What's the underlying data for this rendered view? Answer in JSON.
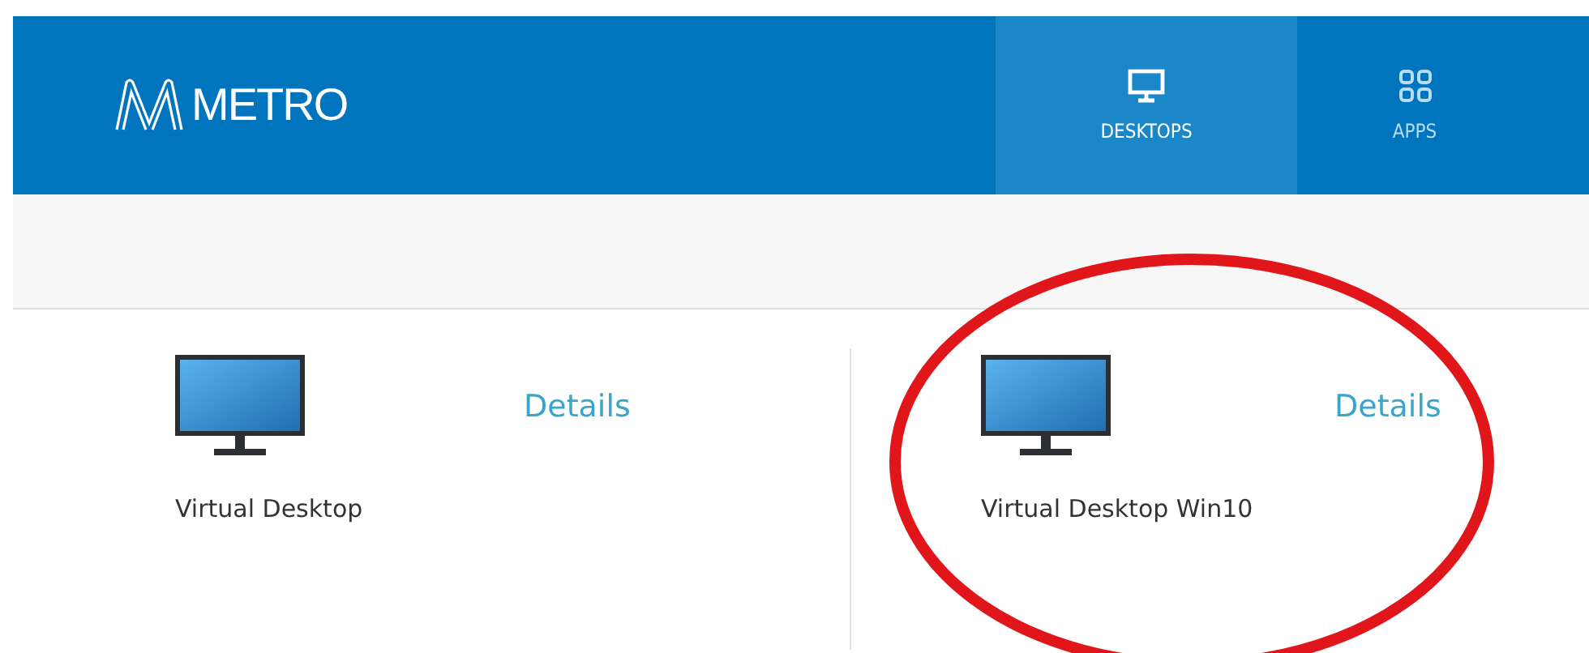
{
  "header": {
    "logo": "METRO",
    "tabs": [
      {
        "label": "DESKTOPS",
        "kind": "desktop",
        "selected": true
      },
      {
        "label": "APPS",
        "kind": "apps",
        "selected": false
      }
    ]
  },
  "desktops": [
    {
      "name": "Virtual Desktop",
      "link": "Details",
      "circled": false
    },
    {
      "name": "Virtual Desktop Win10",
      "link": "Details",
      "circled": true
    }
  ]
}
